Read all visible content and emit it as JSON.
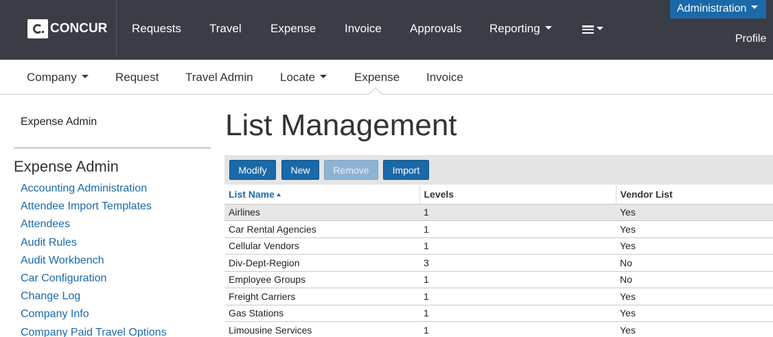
{
  "brand": {
    "name": "CONCUR"
  },
  "topnav": {
    "items": [
      {
        "label": "Requests"
      },
      {
        "label": "Travel"
      },
      {
        "label": "Expense"
      },
      {
        "label": "Invoice"
      },
      {
        "label": "Approvals"
      },
      {
        "label": "Reporting"
      }
    ],
    "menu_icon": "hamburger-menu-icon",
    "admin_label": "Administration",
    "profile_label": "Profile"
  },
  "subnav": {
    "items": [
      {
        "label": "Company"
      },
      {
        "label": "Request"
      },
      {
        "label": "Travel Admin"
      },
      {
        "label": "Locate"
      },
      {
        "label": "Expense"
      },
      {
        "label": "Invoice"
      }
    ],
    "active": "Expense"
  },
  "sidebar": {
    "top_link": "Expense Admin",
    "heading": "Expense Admin",
    "items": [
      "Accounting Administration",
      "Attendee Import Templates",
      "Attendees",
      "Audit Rules",
      "Audit Workbench",
      "Car Configuration",
      "Change Log",
      "Company Info",
      "Company Paid Travel Options"
    ]
  },
  "main": {
    "title": "List Management",
    "toolbar": {
      "modify": "Modify",
      "new": "New",
      "remove": "Remove",
      "import": "Import"
    },
    "table": {
      "columns": [
        "List Name",
        "Levels",
        "Vendor List"
      ],
      "rows": [
        [
          "Airlines",
          "1",
          "Yes"
        ],
        [
          "Car Rental Agencies",
          "1",
          "Yes"
        ],
        [
          "Cellular Vendors",
          "1",
          "Yes"
        ],
        [
          "Div-Dept-Region",
          "3",
          "No"
        ],
        [
          "Employee Groups",
          "1",
          "No"
        ],
        [
          "Freight Carriers",
          "1",
          "Yes"
        ],
        [
          "Gas Stations",
          "1",
          "Yes"
        ],
        [
          "Limousine Services",
          "1",
          "Yes"
        ]
      ]
    }
  },
  "colors": {
    "topbar": "#3a3c46",
    "accent": "#1a69a8",
    "toolbar_bg": "#e4e4e4"
  }
}
